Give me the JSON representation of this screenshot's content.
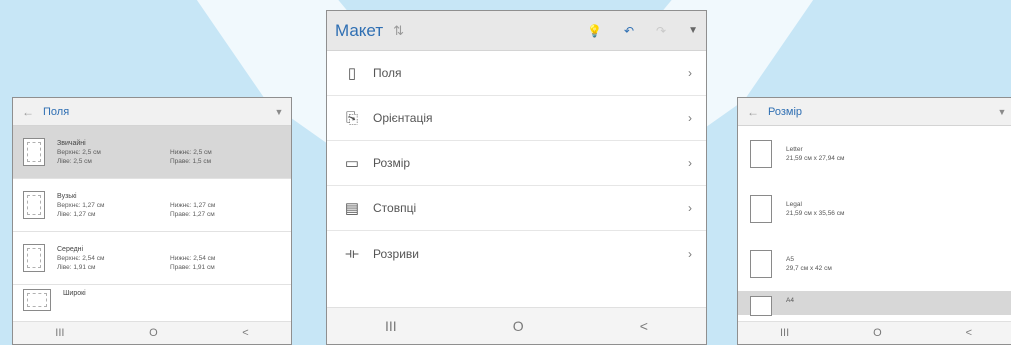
{
  "left_panel": {
    "back_icon": "back-arrow-icon",
    "title": "Поля",
    "items": [
      {
        "name": "Звичайні",
        "top": "Верхнє: 2,5 см",
        "left": "Ліве: 2,5 см",
        "bottom": "Нижнє: 2,5 см",
        "right": "Праве: 1,5 см",
        "selected": true
      },
      {
        "name": "Вузькі",
        "top": "Верхнє: 1,27 см",
        "left": "Ліве: 1,27 см",
        "bottom": "Нижнє: 1,27 см",
        "right": "Праве: 1,27 см",
        "selected": false
      },
      {
        "name": "Середні",
        "top": "Верхнє: 2,54 см",
        "left": "Ліве: 1,91 см",
        "bottom": "Нижнє: 2,54 см",
        "right": "Праве: 1,91 см",
        "selected": false
      },
      {
        "name": "Широкі",
        "top": "",
        "left": "",
        "bottom": "",
        "right": "",
        "selected": false
      }
    ],
    "nav": [
      "III",
      "O",
      "<"
    ]
  },
  "center_panel": {
    "title": "Макет",
    "items": [
      {
        "label": "Поля",
        "icon": "margins-icon"
      },
      {
        "label": "Орієнтація",
        "icon": "orientation-icon"
      },
      {
        "label": "Розмір",
        "icon": "page-size-icon"
      },
      {
        "label": "Стовпці",
        "icon": "columns-icon"
      },
      {
        "label": "Розриви",
        "icon": "breaks-icon"
      }
    ],
    "nav": [
      "III",
      "O",
      "<"
    ]
  },
  "right_panel": {
    "title": "Розмір",
    "items": [
      {
        "name": "Letter",
        "size": "21,59 см x 27,94 см",
        "selected": false
      },
      {
        "name": "Legal",
        "size": "21,59 см x 35,56 см",
        "selected": false
      },
      {
        "name": "A5",
        "size": "29,7 см x 42 см",
        "selected": false
      },
      {
        "name": "A4",
        "size": "",
        "selected": true
      }
    ],
    "nav": [
      "III",
      "O",
      "<"
    ]
  }
}
